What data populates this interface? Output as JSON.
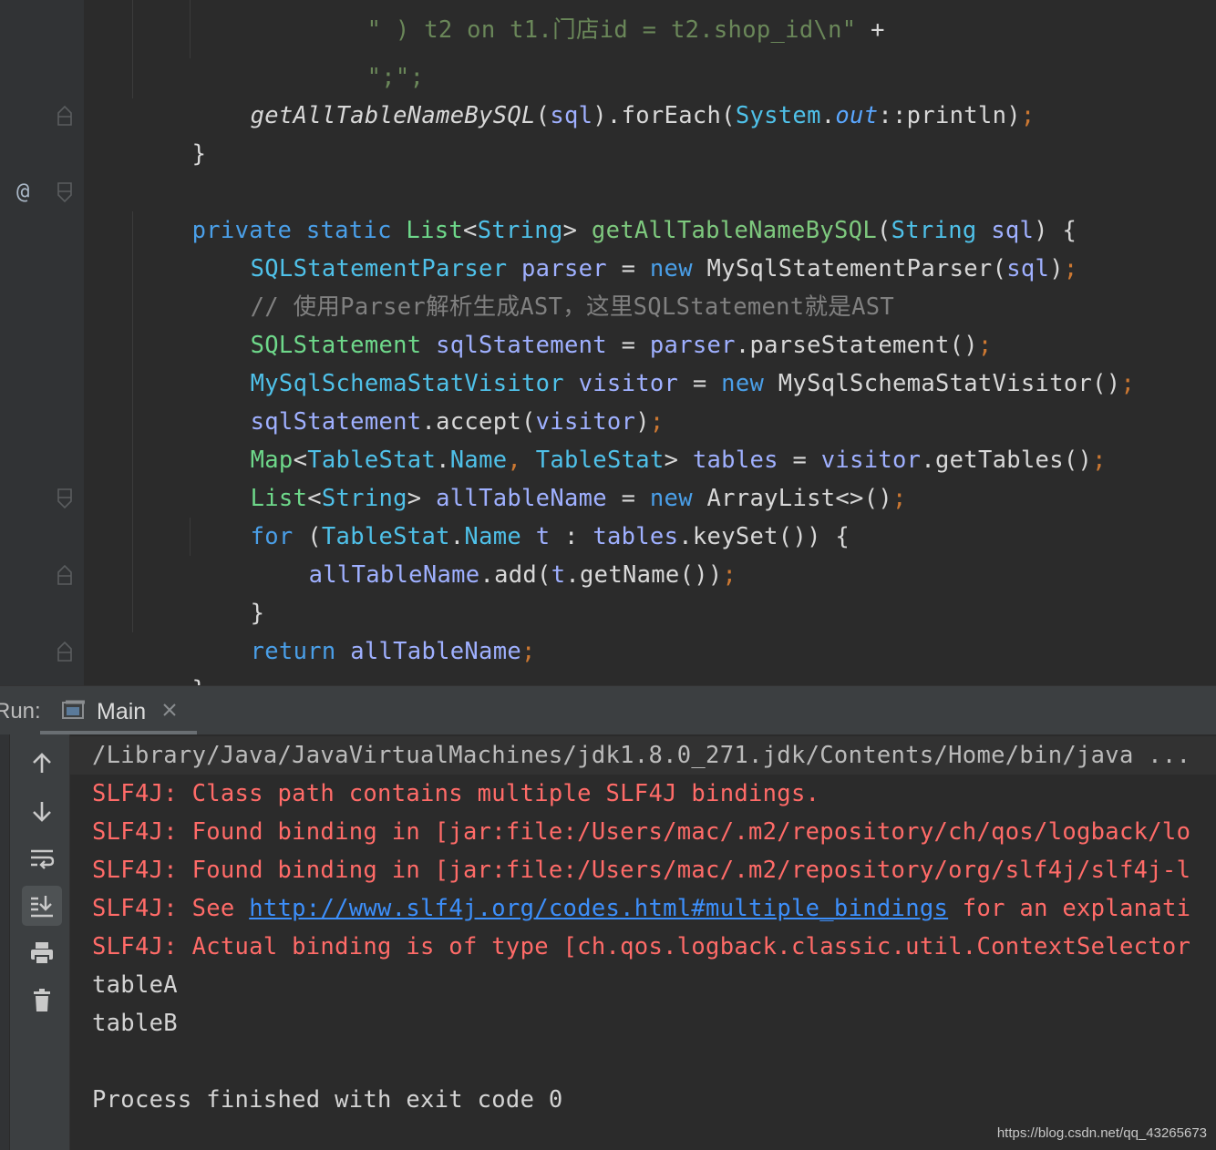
{
  "editor": {
    "line_concat": "\";\";",
    "line_forEach": {
      "call": "getAllTableNameBySQL",
      "arg": "sql",
      "rest1": ").forEach(",
      "system": "System",
      "dot": ".",
      "out": "out",
      "rest2": "::println)",
      "semi": ";"
    },
    "brace_close": "}",
    "method_signature": {
      "private": "private",
      "static": "static",
      "list": "List",
      "lt": "<",
      "string": "String",
      "gt": ">",
      "name": "getAllTableNameBySQL",
      "paren_open": "(",
      "param_type": "String",
      "param_name": "sql",
      "paren_close": ")",
      "brace": "{"
    },
    "line_parser": {
      "type": "SQLStatementParser",
      "var": "parser",
      "eq": "=",
      "new": "new",
      "ctor": "MySqlStatementParser(",
      "arg": "sql",
      "close": ")",
      "semi": ";"
    },
    "comment": "// 使用Parser解析生成AST，这里SQLStatement就是AST",
    "line_statement": {
      "type": "SQLStatement",
      "var": "sqlStatement",
      "eq": "=",
      "obj": "parser",
      "call": ".parseStatement()",
      "semi": ";"
    },
    "line_visitor": {
      "type": "MySqlSchemaStatVisitor",
      "var": "visitor",
      "eq": "=",
      "new": "new",
      "ctor": "MySqlSchemaStatVisitor()",
      "semi": ";"
    },
    "line_accept": {
      "obj": "sqlStatement",
      "call": ".accept(",
      "arg": "visitor",
      "close": ")",
      "semi": ";"
    },
    "line_tables": {
      "map": "Map",
      "lt": "<",
      "t1": "TableStat",
      "dot1": ".",
      "n1": "Name",
      "comma": ",",
      "t2": "TableStat",
      "gt": ">",
      "var": "tables",
      "eq": "=",
      "obj": "visitor",
      "call": ".getTables()",
      "semi": ";"
    },
    "line_list": {
      "list": "List",
      "lt": "<",
      "string": "String",
      "gt": ">",
      "var": "allTableName",
      "eq": "=",
      "new": "new",
      "ctor": "ArrayList<>()",
      "semi": ";"
    },
    "line_for": {
      "for": "for",
      "open": "(",
      "type": "TableStat",
      "dot": ".",
      "name": "Name",
      "var": "t",
      "colon": ":",
      "obj": "tables",
      "call": ".keySet())",
      "brace": "{"
    },
    "line_add": {
      "obj": "allTableName",
      "call": ".add(",
      "arg": "t",
      "call2": ".getName())",
      "semi": ";"
    },
    "line_return": {
      "return": "return",
      "var": "allTableName",
      "semi": ";"
    },
    "at_marker": "@"
  },
  "run": {
    "label": "Run:",
    "tab_label": "Main",
    "console": {
      "command": "/Library/Java/JavaVirtualMachines/jdk1.8.0_271.jdk/Contents/Home/bin/java ...",
      "lines": [
        "SLF4J: Class path contains multiple SLF4J bindings.",
        "SLF4J: Found binding in [jar:file:/Users/mac/.m2/repository/ch/qos/logback/lo",
        "SLF4J: Found binding in [jar:file:/Users/mac/.m2/repository/org/slf4j/slf4j-l"
      ],
      "see_prefix": "SLF4J: See ",
      "see_link": "http://www.slf4j.org/codes.html#multiple_bindings",
      "see_suffix": " for an explanati",
      "actual_binding": "SLF4J: Actual binding is of type [ch.qos.logback.classic.util.ContextSelector",
      "output": [
        "tableA",
        "tableB"
      ],
      "exit_message": "Process finished with exit code 0"
    }
  },
  "watermark": "https://blog.csdn.net/qq_43265673",
  "colors": {
    "background": "#2b2b2b",
    "keyword": "#cc7832",
    "error": "#ff6b68",
    "link": "#3d8ffa"
  }
}
